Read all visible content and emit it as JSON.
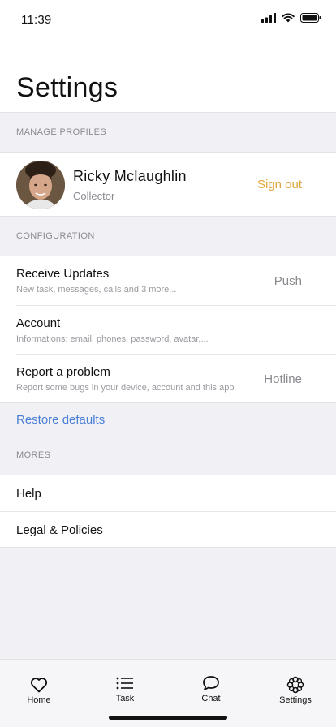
{
  "status_bar": {
    "time": "11:39"
  },
  "page_title": "Settings",
  "manage_profiles": {
    "header": "MANAGE PROFILES",
    "profile": {
      "name": "Ricky Mclaughlin",
      "role": "Collector",
      "signout_label": "Sign out"
    }
  },
  "configuration": {
    "header": "CONFIGURATION",
    "items": [
      {
        "title": "Receive Updates",
        "subtitle": "New task, messages, calls and 3 more...",
        "value": "Push"
      },
      {
        "title": "Account",
        "subtitle": "Informations: email, phones, password, avatar,...",
        "value": ""
      },
      {
        "title": "Report a problem",
        "subtitle": "Report some bugs in your device, account and this app",
        "value": "Hotline"
      }
    ],
    "restore_label": "Restore defaults"
  },
  "mores": {
    "header": "MORES",
    "items": [
      {
        "title": "Help"
      },
      {
        "title": "Legal & Policies"
      }
    ]
  },
  "tabbar": {
    "items": [
      {
        "label": "Home",
        "icon": "heart-icon"
      },
      {
        "label": "Task",
        "icon": "list-icon"
      },
      {
        "label": "Chat",
        "icon": "chat-bubble-icon"
      },
      {
        "label": "Settings",
        "icon": "settings-flower-icon"
      }
    ]
  },
  "colors": {
    "accent_signout": "#e0a53c",
    "link_blue": "#4a7fd8",
    "background": "#f1f1f5"
  }
}
